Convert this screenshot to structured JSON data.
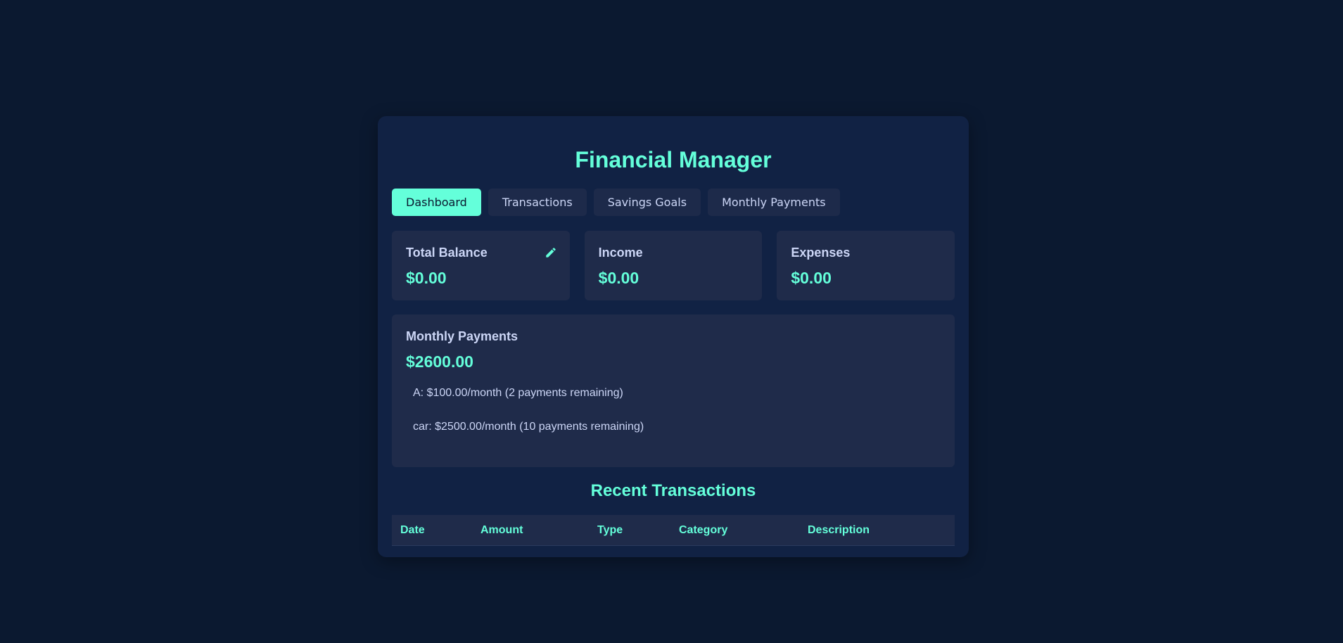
{
  "app": {
    "title": "Financial Manager"
  },
  "tabs": [
    {
      "label": "Dashboard",
      "active": true
    },
    {
      "label": "Transactions",
      "active": false
    },
    {
      "label": "Savings Goals",
      "active": false
    },
    {
      "label": "Monthly Payments",
      "active": false
    }
  ],
  "summary": {
    "balance": {
      "label": "Total Balance",
      "value": "$0.00",
      "icon": "pencil-icon"
    },
    "income": {
      "label": "Income",
      "value": "$0.00"
    },
    "expenses": {
      "label": "Expenses",
      "value": "$0.00"
    }
  },
  "monthly_payments": {
    "label": "Monthly Payments",
    "total": "$2600.00",
    "items": [
      "A: $100.00/month (2 payments remaining)",
      "car: $2500.00/month (10 payments remaining)"
    ]
  },
  "recent_transactions": {
    "title": "Recent Transactions",
    "columns": [
      "Date",
      "Amount",
      "Type",
      "Category",
      "Description"
    ]
  },
  "colors": {
    "background": "#0b1930",
    "panel": "#112244",
    "card": "#1f2b4a",
    "accent": "#64ffda",
    "text": "#ccd6f6"
  }
}
